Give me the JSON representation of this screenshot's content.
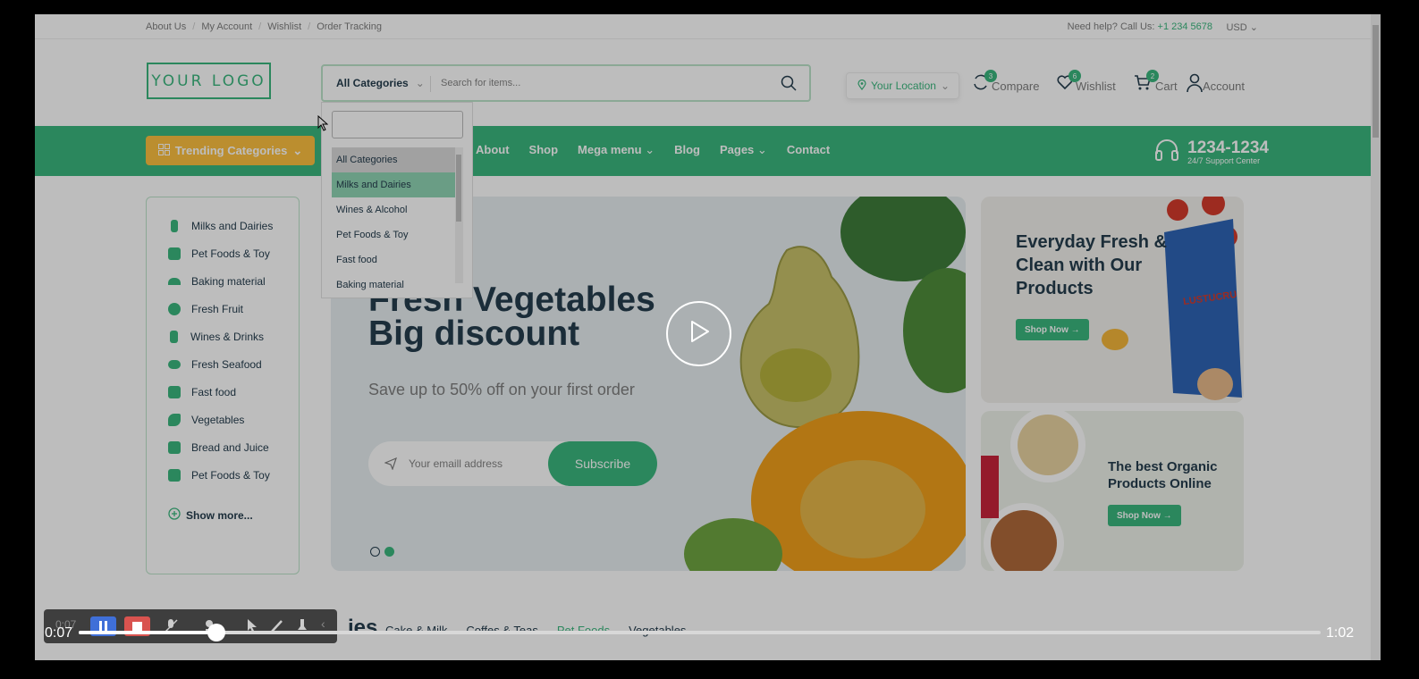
{
  "topbar": {
    "links": [
      "About Us",
      "My Account",
      "Wishlist",
      "Order Tracking"
    ],
    "help_prefix": "Need help? Call Us: ",
    "help_phone": "+1 234 5678",
    "currency": "USD"
  },
  "header": {
    "logo": "YOUR LOGO",
    "category_select": "All Categories",
    "search_placeholder": "Search for items...",
    "location": "Your Location",
    "compare_label": "Compare",
    "compare_count": "3",
    "wishlist_label": "Wishlist",
    "wishlist_count": "6",
    "cart_label": "Cart",
    "cart_count": "2",
    "account_label": "Account"
  },
  "nav": {
    "trending": "Trending Categories",
    "links": [
      "About",
      "Shop",
      "Mega menu",
      "Blog",
      "Pages",
      "Contact"
    ],
    "support_number": "1234-1234",
    "support_sub": "24/7 Support Center"
  },
  "dropdown": {
    "options": [
      "All Categories",
      "Milks and Dairies",
      "Wines & Alcohol",
      "Pet Foods & Toy",
      "Fast food",
      "Baking material"
    ]
  },
  "sidebar": {
    "items": [
      "Milks and Dairies",
      "Pet Foods & Toy",
      "Baking material",
      "Fresh Fruit",
      "Wines & Drinks",
      "Fresh Seafood",
      "Fast food",
      "Vegetables",
      "Bread and Juice",
      "Pet Foods & Toy"
    ],
    "show_more": "Show more..."
  },
  "hero": {
    "title_line1": "Fresh Vegetables",
    "title_line2": "Big discount",
    "subtitle": "Save up to 50% off on your first order",
    "email_placeholder": "Your emaill address",
    "subscribe": "Subscribe"
  },
  "banners": {
    "b1_title_1": "Everyday Fresh &",
    "b1_title_2": "Clean with Our",
    "b1_title_3": "Products",
    "b1_btn": "Shop Now",
    "b2_title_1": "The best Organic",
    "b2_title_2": "Products Online",
    "b2_btn": "Shop Now",
    "pack_text": "LUSTUCRU"
  },
  "tabs": {
    "partial_heading": "ies",
    "items": [
      "Cake & Milk",
      "Coffes & Teas",
      "Pet Foods",
      "Vegetables"
    ]
  },
  "video": {
    "current_time": "0:07",
    "toolbar_time": "0:07",
    "duration": "1:02",
    "progress": 0.111
  },
  "colors": {
    "brand_green": "#3bb77e",
    "trending_yellow": "#fdc040",
    "text_dark": "#253d4e"
  }
}
